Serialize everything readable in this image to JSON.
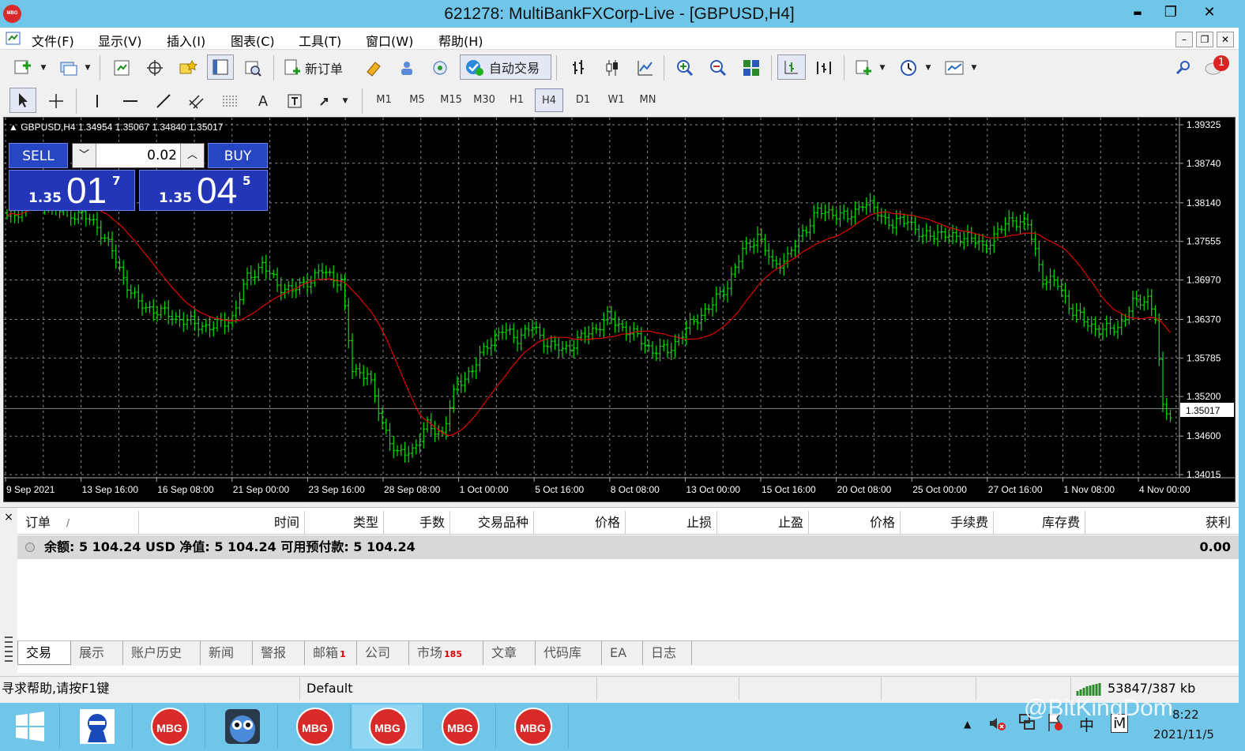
{
  "window": {
    "title": "621278: MultiBankFXCorp-Live - [GBPUSD,H4]",
    "logo_text": "MBG",
    "minimize": "▬",
    "restore": "❐",
    "close": "✕"
  },
  "menu": [
    "文件(F)",
    "显示(V)",
    "插入(I)",
    "图表(C)",
    "工具(T)",
    "窗口(W)",
    "帮助(H)"
  ],
  "mdi_controls": [
    "–",
    "❐",
    "✕"
  ],
  "toolbar": {
    "new_order_label": "新订单",
    "auto_trade_label": "自动交易",
    "notification_count": "1",
    "timeframes": [
      "M1",
      "M5",
      "M15",
      "M30",
      "H1",
      "H4",
      "D1",
      "W1",
      "MN"
    ],
    "active_timeframe": "H4"
  },
  "chart": {
    "symbol_line": "GBPUSD,H4  1.34954 1.35067 1.34840 1.35017",
    "current_price_label": "1.35017",
    "bull_color": "#00e000",
    "ma_color": "#e00000",
    "grid_color": "#8a8a8a",
    "one_click": {
      "sell_label": "SELL",
      "buy_label": "BUY",
      "lot": "0.02",
      "sell_small": "1.35",
      "sell_big": "01",
      "sell_sup": "7",
      "buy_small": "1.35",
      "buy_big": "04",
      "buy_sup": "5"
    }
  },
  "chart_data": {
    "type": "candlestick",
    "title": "GBPUSD,H4",
    "ohlc_latest": {
      "open": 1.34954,
      "high": 1.35067,
      "low": 1.3484,
      "close": 1.35017
    },
    "y_ticks": [
      "1.39325",
      "1.38740",
      "1.38140",
      "1.37555",
      "1.36970",
      "1.36370",
      "1.35785",
      "1.35200",
      "1.34600",
      "1.34015"
    ],
    "x_ticks": [
      "9 Sep 2021",
      "13 Sep 16:00",
      "16 Sep 08:00",
      "21 Sep 00:00",
      "23 Sep 16:00",
      "28 Sep 08:00",
      "1 Oct 00:00",
      "5 Oct 16:00",
      "8 Oct 08:00",
      "13 Oct 00:00",
      "15 Oct 16:00",
      "20 Oct 08:00",
      "25 Oct 00:00",
      "27 Oct 16:00",
      "1 Nov 08:00",
      "4 Nov 00:00"
    ],
    "ylim": [
      1.34015,
      1.39325
    ],
    "current_price": 1.35017,
    "close_path": [
      [
        0,
        1.379
      ],
      [
        4,
        1.3805
      ],
      [
        8,
        1.383
      ],
      [
        11,
        1.381
      ],
      [
        15,
        1.38
      ],
      [
        20,
        1.3795
      ],
      [
        24,
        1.378
      ],
      [
        28,
        1.374
      ],
      [
        31,
        1.37
      ],
      [
        35,
        1.366
      ],
      [
        40,
        1.365
      ],
      [
        45,
        1.364
      ],
      [
        50,
        1.363
      ],
      [
        55,
        1.3625
      ],
      [
        60,
        1.364
      ],
      [
        64,
        1.37
      ],
      [
        68,
        1.372
      ],
      [
        72,
        1.369
      ],
      [
        76,
        1.368
      ],
      [
        80,
        1.3695
      ],
      [
        84,
        1.371
      ],
      [
        89,
        1.3695
      ],
      [
        92,
        1.356
      ],
      [
        96,
        1.3555
      ],
      [
        100,
        1.348
      ],
      [
        104,
        1.343
      ],
      [
        108,
        1.344
      ],
      [
        112,
        1.3475
      ],
      [
        116,
        1.3465
      ],
      [
        120,
        1.354
      ],
      [
        124,
        1.356
      ],
      [
        128,
        1.36
      ],
      [
        132,
        1.362
      ],
      [
        136,
        1.361
      ],
      [
        140,
        1.3625
      ],
      [
        144,
        1.36
      ],
      [
        148,
        1.359
      ],
      [
        152,
        1.3605
      ],
      [
        156,
        1.362
      ],
      [
        160,
        1.364
      ],
      [
        164,
        1.3625
      ],
      [
        168,
        1.361
      ],
      [
        172,
        1.359
      ],
      [
        176,
        1.359
      ],
      [
        180,
        1.3615
      ],
      [
        184,
        1.364
      ],
      [
        188,
        1.366
      ],
      [
        192,
        1.369
      ],
      [
        196,
        1.374
      ],
      [
        200,
        1.3765
      ],
      [
        204,
        1.372
      ],
      [
        208,
        1.373
      ],
      [
        212,
        1.377
      ],
      [
        216,
        1.38
      ],
      [
        220,
        1.38
      ],
      [
        224,
        1.379
      ],
      [
        228,
        1.3815
      ],
      [
        232,
        1.38
      ],
      [
        236,
        1.378
      ],
      [
        240,
        1.379
      ],
      [
        244,
        1.376
      ],
      [
        248,
        1.377
      ],
      [
        252,
        1.376
      ],
      [
        256,
        1.3765
      ],
      [
        260,
        1.3745
      ],
      [
        264,
        1.377
      ],
      [
        268,
        1.379
      ],
      [
        272,
        1.378
      ],
      [
        276,
        1.37
      ],
      [
        280,
        1.369
      ],
      [
        284,
        1.365
      ],
      [
        288,
        1.363
      ],
      [
        292,
        1.362
      ],
      [
        296,
        1.3625
      ],
      [
        300,
        1.366
      ],
      [
        304,
        1.367
      ],
      [
        306,
        1.364
      ],
      [
        308,
        1.35
      ],
      [
        310,
        1.3495
      ]
    ],
    "ma_period": 20,
    "grid": true
  },
  "terminal": {
    "close": "×",
    "columns": [
      "订单",
      "/",
      "时间",
      "类型",
      "手数",
      "交易品种",
      "价格",
      "止损",
      "止盈",
      "价格",
      "手续费",
      "库存费",
      "获利"
    ],
    "balance_text": "余额: 5 104.24 USD  净值: 5 104.24  可用预付款: 5 104.24",
    "balance_profit": "0.00",
    "tabs": [
      {
        "label": "交易",
        "badge": ""
      },
      {
        "label": "展示",
        "badge": ""
      },
      {
        "label": "账户历史",
        "badge": ""
      },
      {
        "label": "新闻",
        "badge": ""
      },
      {
        "label": "警报",
        "badge": ""
      },
      {
        "label": "邮箱",
        "badge": "1"
      },
      {
        "label": "公司",
        "badge": ""
      },
      {
        "label": "市场",
        "badge": "185"
      },
      {
        "label": "文章",
        "badge": ""
      },
      {
        "label": "代码库",
        "badge": ""
      },
      {
        "label": "EA",
        "badge": ""
      },
      {
        "label": "日志",
        "badge": ""
      }
    ],
    "active_tab": "交易"
  },
  "statusbar": {
    "help": "寻求帮助,请按F1键",
    "profile": "Default",
    "traffic": "53847/387 kb"
  },
  "taskbar": {
    "app_label": "MBG",
    "watermark": "@BitKingDom",
    "time": "8:22",
    "date": "2021/11/5",
    "ime": "中",
    "ime_mode": "M"
  }
}
